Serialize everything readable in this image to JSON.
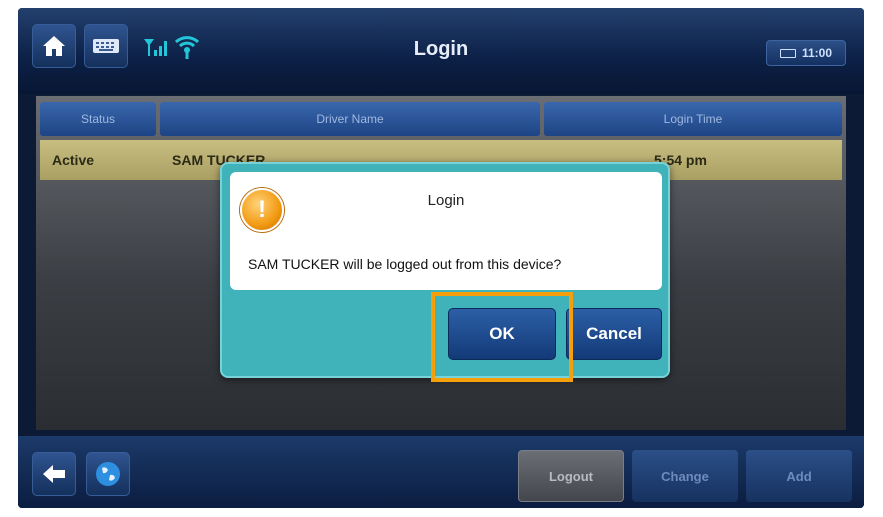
{
  "header": {
    "title": "Login",
    "clock": "11:00",
    "icons": [
      "home-icon",
      "keyboard-icon",
      "signal-icon",
      "wifi-icon"
    ]
  },
  "table": {
    "columns": [
      "Status",
      "Driver Name",
      "Login Time"
    ],
    "rows": [
      {
        "status": "Active",
        "driver": "SAM TUCKER",
        "time": "5:54 pm"
      }
    ]
  },
  "dialog": {
    "title": "Login",
    "message": "SAM TUCKER will be logged out from this device?",
    "ok_label": "OK",
    "cancel_label": "Cancel"
  },
  "footer": {
    "logout_label": "Logout",
    "change_label": "Change",
    "add_label": "Add",
    "icons": [
      "back-arrow-icon",
      "globe-icon"
    ]
  },
  "colors": {
    "highlight": "#f5a00a",
    "dialog_bg": "#3fb2ba",
    "row_active": "#c9be82",
    "button_blue": "#1f4f92"
  }
}
